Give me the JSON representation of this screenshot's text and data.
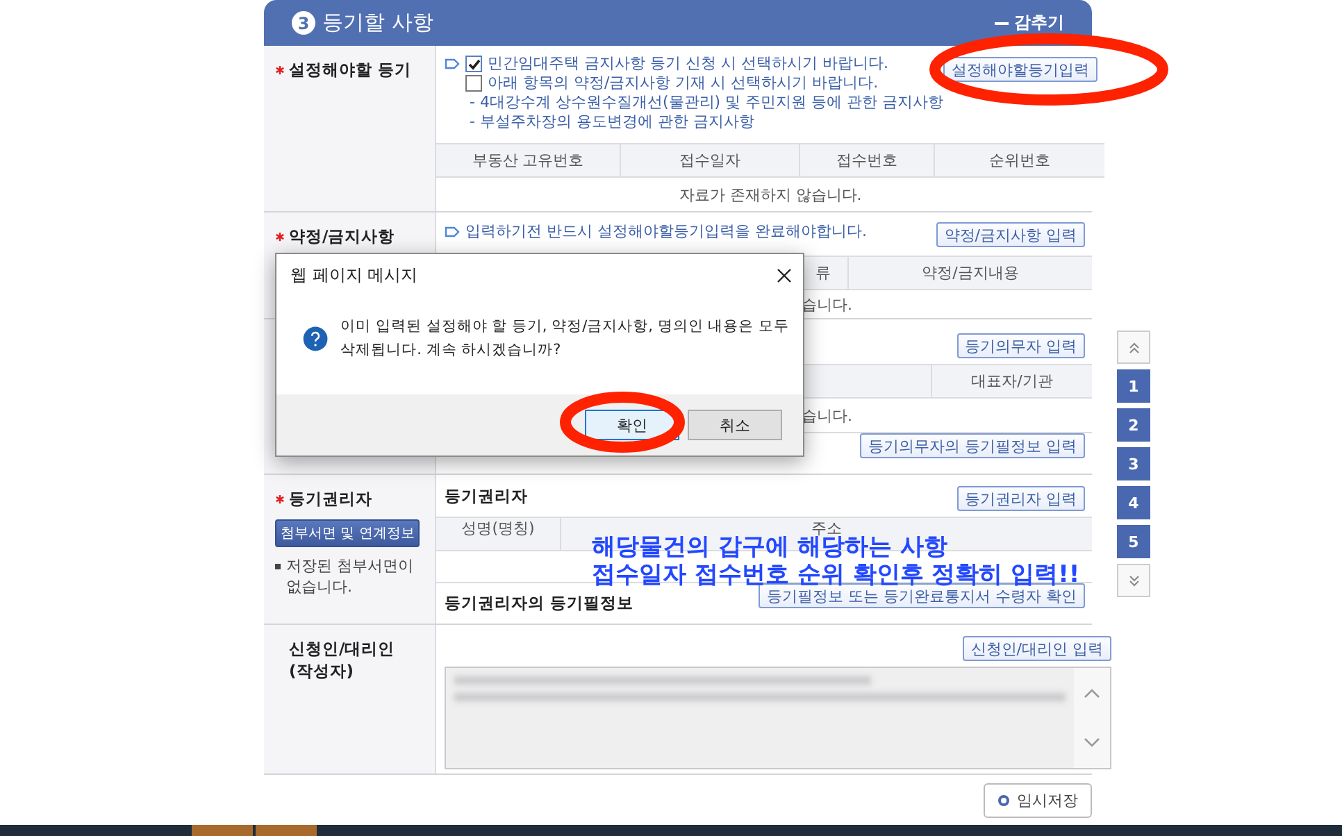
{
  "section": {
    "number": "3",
    "title": "등기할 사항",
    "collapse": "감추기"
  },
  "rows": [
    {
      "kind": "settings",
      "label": [
        "설정해야할 등기"
      ],
      "required": true,
      "button": "설정해야할등기입력",
      "options": [
        {
          "text": "민간임대주택 금지사항 등기 신청 시 선택하시기 바랍니다.",
          "checked": true
        },
        {
          "text": "아래 항목의 약정/금지사항 기재 시 선택하시기 바랍니다.",
          "checked": false
        }
      ],
      "notes": [
        "- 4대강수계 상수원수질개선(물관리) 및 주민지원 등에 관한 금지사항",
        "- 부설주차장의 용도변경에 관한 금지사항"
      ],
      "columns": [
        "부동산 고유번호",
        "접수일자",
        "접수번호",
        "순위번호"
      ],
      "empty": "자료가 존재하지 않습니다."
    },
    {
      "kind": "restriction",
      "label": [
        "약정/금지사항"
      ],
      "required": true,
      "hint": "입력하기전 반드시 설정해야할등기입력을 완료해야합니다.",
      "button": "약정/금지사항 입력",
      "columns": [
        "류",
        "약정/금지내용"
      ],
      "empty": "습니다."
    },
    {
      "kind": "obligor",
      "button": "등기의무자 입력",
      "columns": [
        "대표자/기관"
      ],
      "empty": "습니다.",
      "sub": {
        "button": "등기의무자의 등기필정보 입력"
      }
    },
    {
      "kind": "holder",
      "label": [
        "등기권리자"
      ],
      "required": true,
      "side_button": "첨부서면 및 연계정보",
      "side_note": "저장된 첨부서면이 없습니다.",
      "title": "등기권리자",
      "button": "등기권리자 입력",
      "columns": [
        "성명(명칭)",
        "주소"
      ],
      "sub": {
        "title": "등기권리자의 등기필정보",
        "button": "등기필정보 또는 등기완료통지서 수령자 확인"
      }
    },
    {
      "kind": "applicant",
      "label": [
        "신청인/대리인",
        "(작성자)"
      ],
      "required": false,
      "button": "신청인/대리인 입력"
    }
  ],
  "save_button": "임시저장",
  "nav": {
    "pages": [
      "1",
      "2",
      "3",
      "4",
      "5"
    ]
  },
  "dialog": {
    "title": "웹 페이지 메시지",
    "lines": [
      "이미 입력된 설정해야 할 등기, 약정/금지사항, 명의인 내용은 모두",
      "삭제됩니다. 계속 하시겠습니까?"
    ],
    "buttons": [
      {
        "label": "확인",
        "default": true
      },
      {
        "label": "취소",
        "default": false
      }
    ]
  },
  "annotation": {
    "lines": [
      "해당물건의 갑구에 해당하는 사항",
      "접수일자 접수번호 순위 확인후 정확히 입력!!"
    ]
  }
}
